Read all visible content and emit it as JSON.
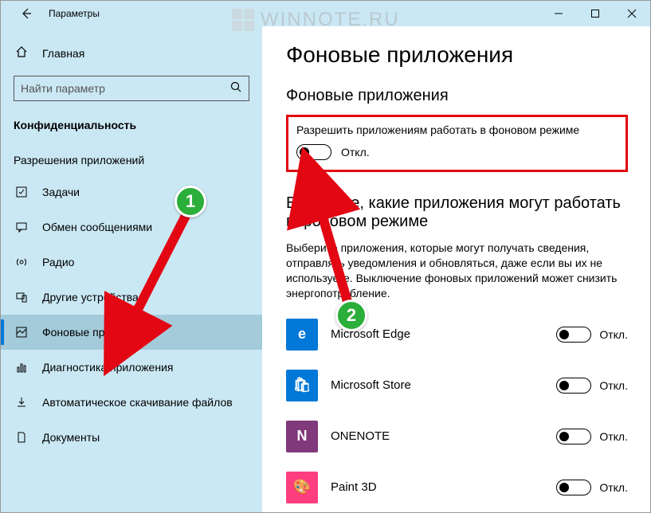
{
  "window": {
    "title": "Параметры"
  },
  "watermark": {
    "text": "WINNOTE.RU"
  },
  "sidebar": {
    "home": "Главная",
    "search_placeholder": "Найти параметр",
    "section": "Конфиденциальность",
    "subsection": "Разрешения приложений",
    "items": [
      {
        "label": "Задачи"
      },
      {
        "label": "Обмен сообщениями"
      },
      {
        "label": "Радио"
      },
      {
        "label": "Другие устройства"
      },
      {
        "label": "Фоновые приложения"
      },
      {
        "label": "Диагностика приложения"
      },
      {
        "label": "Автоматическое скачивание файлов"
      },
      {
        "label": "Документы"
      }
    ]
  },
  "main": {
    "title": "Фоновые приложения",
    "s1_title": "Фоновые приложения",
    "s1_desc": "Разрешить приложениям работать в фоновом режиме",
    "s1_toggle": "Откл.",
    "s2_title": "Выберите, какие приложения могут работать в фоновом режиме",
    "s2_desc": "Выберите приложения, которые могут получать сведения, отправлять уведомления и обновляться, даже если вы их не используете. Выключение фоновых приложений может снизить энергопотребление.",
    "apps": [
      {
        "name": "Microsoft Edge",
        "state": "Откл.",
        "bg": "#0078d7",
        "glyph": "e"
      },
      {
        "name": "Microsoft Store",
        "state": "Откл.",
        "bg": "#0078d7",
        "glyph": "🛍"
      },
      {
        "name": "ONENOTE",
        "state": "Откл.",
        "bg": "#80397b",
        "glyph": "N"
      },
      {
        "name": "Paint 3D",
        "state": "Откл.",
        "bg": "#ff3e7f",
        "glyph": "🎨"
      }
    ]
  },
  "markers": {
    "one": "1",
    "two": "2"
  }
}
